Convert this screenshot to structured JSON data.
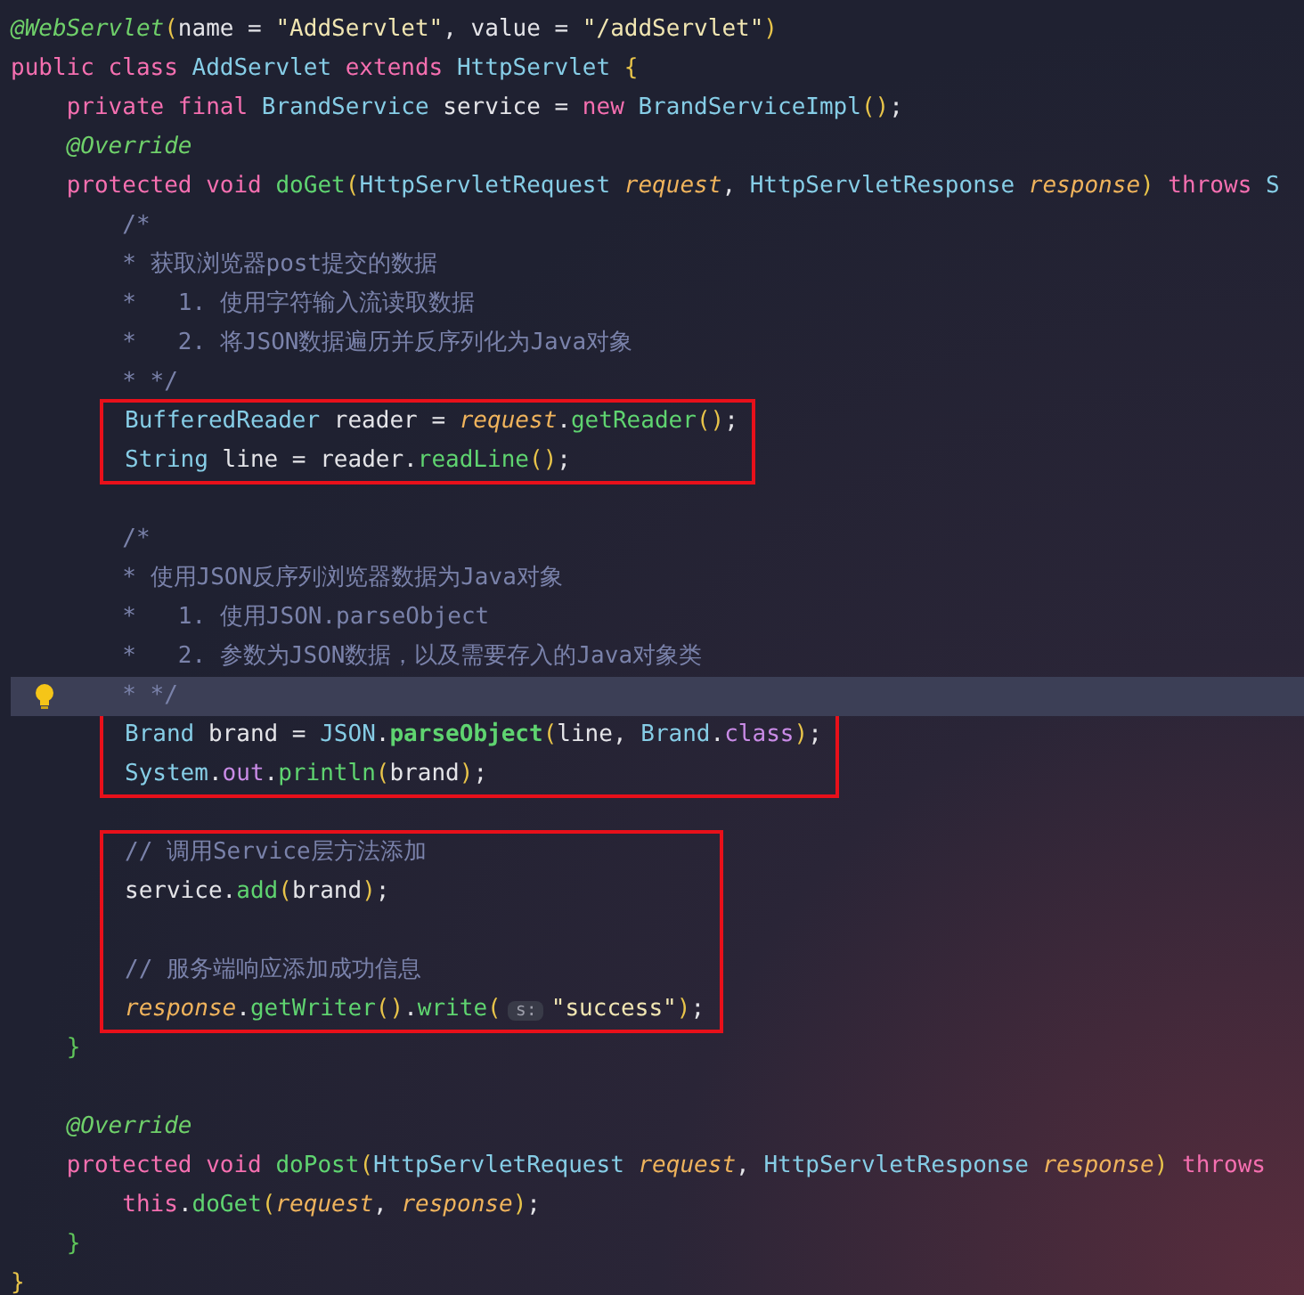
{
  "editor": {
    "blocks": [
      {
        "boxed": false,
        "lines": [
          {
            "current": false,
            "tokens": [
              {
                "text": "@WebServlet",
                "kind": "annotation"
              },
              {
                "text": "(",
                "kind": "paren"
              },
              {
                "text": "name = ",
                "kind": "plain"
              },
              {
                "text": "\"AddServlet\"",
                "kind": "string"
              },
              {
                "text": ", value = ",
                "kind": "plain"
              },
              {
                "text": "\"/addServlet\"",
                "kind": "string"
              },
              {
                "text": ")",
                "kind": "paren"
              }
            ]
          },
          {
            "current": false,
            "tokens": [
              {
                "text": "public class ",
                "kind": "keyword"
              },
              {
                "text": "AddServlet ",
                "kind": "type"
              },
              {
                "text": "extends ",
                "kind": "keyword"
              },
              {
                "text": "HttpServlet ",
                "kind": "type"
              },
              {
                "text": "{",
                "kind": "paren"
              }
            ]
          },
          {
            "current": false,
            "tokens": [
              {
                "text": "    private final ",
                "kind": "keyword"
              },
              {
                "text": "BrandService ",
                "kind": "type"
              },
              {
                "text": "service = ",
                "kind": "plain"
              },
              {
                "text": "new ",
                "kind": "keyword"
              },
              {
                "text": "BrandServiceImpl",
                "kind": "type"
              },
              {
                "text": "()",
                "kind": "paren"
              },
              {
                "text": ";",
                "kind": "plain"
              }
            ]
          },
          {
            "current": false,
            "tokens": [
              {
                "text": "    @Override",
                "kind": "annotation"
              }
            ]
          },
          {
            "current": false,
            "tokens": [
              {
                "text": "    protected void ",
                "kind": "keyword"
              },
              {
                "text": "doGet",
                "kind": "method"
              },
              {
                "text": "(",
                "kind": "paren"
              },
              {
                "text": "HttpServletRequest ",
                "kind": "type"
              },
              {
                "text": "request",
                "kind": "param"
              },
              {
                "text": ", ",
                "kind": "plain"
              },
              {
                "text": "HttpServletResponse ",
                "kind": "type"
              },
              {
                "text": "response",
                "kind": "param"
              },
              {
                "text": ")",
                "kind": "paren"
              },
              {
                "text": " throws ",
                "kind": "keyword"
              },
              {
                "text": "S",
                "kind": "type"
              }
            ]
          },
          {
            "current": false,
            "tokens": [
              {
                "text": "        /*",
                "kind": "comment"
              }
            ]
          },
          {
            "current": false,
            "tokens": [
              {
                "text": "        * 获取浏览器post提交的数据",
                "kind": "comment"
              }
            ]
          },
          {
            "current": false,
            "tokens": [
              {
                "text": "        *   1. 使用字符输入流读取数据",
                "kind": "comment"
              }
            ]
          },
          {
            "current": false,
            "tokens": [
              {
                "text": "        *   2. 将JSON数据遍历并反序列化为Java对象",
                "kind": "comment"
              }
            ]
          },
          {
            "current": false,
            "tokens": [
              {
                "text": "        * */",
                "kind": "comment"
              }
            ]
          }
        ]
      },
      {
        "boxed": true,
        "lines": [
          {
            "current": false,
            "tokens": [
              {
                "text": "BufferedReader ",
                "kind": "type"
              },
              {
                "text": "reader = ",
                "kind": "plain"
              },
              {
                "text": "request",
                "kind": "param"
              },
              {
                "text": ".",
                "kind": "plain"
              },
              {
                "text": "getReader",
                "kind": "method"
              },
              {
                "text": "()",
                "kind": "paren"
              },
              {
                "text": ";",
                "kind": "plain"
              }
            ]
          },
          {
            "current": false,
            "tokens": [
              {
                "text": "String ",
                "kind": "type"
              },
              {
                "text": "line = reader.",
                "kind": "plain"
              },
              {
                "text": "readLine",
                "kind": "method"
              },
              {
                "text": "()",
                "kind": "paren"
              },
              {
                "text": ";",
                "kind": "plain"
              }
            ]
          }
        ]
      },
      {
        "boxed": false,
        "lines": [
          {
            "current": false
          },
          {
            "current": false,
            "tokens": [
              {
                "text": "        /*",
                "kind": "comment"
              }
            ]
          },
          {
            "current": false,
            "tokens": [
              {
                "text": "        * 使用JSON反序列浏览器数据为Java对象",
                "kind": "comment"
              }
            ]
          },
          {
            "current": false,
            "tokens": [
              {
                "text": "        *   1. 使用JSON.parseObject",
                "kind": "comment"
              }
            ]
          },
          {
            "current": false,
            "tokens": [
              {
                "text": "        *   2. 参数为JSON数据，以及需要存入的Java对象类",
                "kind": "comment"
              }
            ]
          },
          {
            "current": true,
            "tokens": [
              {
                "text": "        * */",
                "kind": "comment"
              }
            ]
          }
        ]
      },
      {
        "boxed": true,
        "lines": [
          {
            "current": false,
            "tokens": [
              {
                "text": "Brand ",
                "kind": "type"
              },
              {
                "text": "brand = ",
                "kind": "plain"
              },
              {
                "text": "JSON",
                "kind": "type"
              },
              {
                "text": ".",
                "kind": "plain"
              },
              {
                "text": "parseObject",
                "kind": "method_bold"
              },
              {
                "text": "(",
                "kind": "paren"
              },
              {
                "text": "line, ",
                "kind": "plain"
              },
              {
                "text": "Brand",
                "kind": "type"
              },
              {
                "text": ".",
                "kind": "plain"
              },
              {
                "text": "class",
                "kind": "field"
              },
              {
                "text": ")",
                "kind": "paren"
              },
              {
                "text": ";",
                "kind": "plain"
              }
            ]
          },
          {
            "current": false,
            "tokens": [
              {
                "text": "System",
                "kind": "type"
              },
              {
                "text": ".",
                "kind": "plain"
              },
              {
                "text": "out",
                "kind": "field"
              },
              {
                "text": ".",
                "kind": "plain"
              },
              {
                "text": "println",
                "kind": "method"
              },
              {
                "text": "(",
                "kind": "paren"
              },
              {
                "text": "brand",
                "kind": "plain"
              },
              {
                "text": ")",
                "kind": "paren"
              },
              {
                "text": ";",
                "kind": "plain"
              }
            ]
          }
        ]
      },
      {
        "boxed": false,
        "lines": [
          {
            "current": false
          }
        ]
      },
      {
        "boxed": true,
        "lines": [
          {
            "current": false,
            "tokens": [
              {
                "text": "// 调用Service层方法添加",
                "kind": "comment"
              }
            ]
          },
          {
            "current": false,
            "tokens": [
              {
                "text": "service.",
                "kind": "plain"
              },
              {
                "text": "add",
                "kind": "method"
              },
              {
                "text": "(",
                "kind": "paren"
              },
              {
                "text": "brand",
                "kind": "plain"
              },
              {
                "text": ")",
                "kind": "paren"
              },
              {
                "text": ";",
                "kind": "plain"
              }
            ]
          },
          {
            "current": false
          },
          {
            "current": false,
            "tokens": [
              {
                "text": "// 服务端响应添加成功信息",
                "kind": "comment"
              }
            ]
          },
          {
            "current": false,
            "tokens": [
              {
                "text": "response",
                "kind": "param"
              },
              {
                "text": ".",
                "kind": "plain"
              },
              {
                "text": "getWriter",
                "kind": "method"
              },
              {
                "text": "()",
                "kind": "paren"
              },
              {
                "text": ".",
                "kind": "plain"
              },
              {
                "text": "write",
                "kind": "method"
              },
              {
                "text": "(",
                "kind": "paren"
              },
              {
                "text": "s:",
                "kind": "hint"
              },
              {
                "text": "\"success\"",
                "kind": "string"
              },
              {
                "text": ")",
                "kind": "paren"
              },
              {
                "text": ";",
                "kind": "plain"
              }
            ]
          }
        ]
      },
      {
        "boxed": false,
        "lines": [
          {
            "current": false,
            "tokens": [
              {
                "text": "    }",
                "kind": "brace"
              }
            ]
          },
          {
            "current": false
          },
          {
            "current": false,
            "tokens": [
              {
                "text": "    @Override",
                "kind": "annotation"
              }
            ]
          },
          {
            "current": false,
            "tokens": [
              {
                "text": "    protected void ",
                "kind": "keyword"
              },
              {
                "text": "doPost",
                "kind": "method"
              },
              {
                "text": "(",
                "kind": "paren"
              },
              {
                "text": "HttpServletRequest ",
                "kind": "type"
              },
              {
                "text": "request",
                "kind": "param"
              },
              {
                "text": ", ",
                "kind": "plain"
              },
              {
                "text": "HttpServletResponse ",
                "kind": "type"
              },
              {
                "text": "response",
                "kind": "param"
              },
              {
                "text": ")",
                "kind": "paren"
              },
              {
                "text": " throws",
                "kind": "keyword"
              }
            ]
          },
          {
            "current": false,
            "tokens": [
              {
                "text": "        this",
                "kind": "keyword"
              },
              {
                "text": ".",
                "kind": "plain"
              },
              {
                "text": "doGet",
                "kind": "method"
              },
              {
                "text": "(",
                "kind": "paren"
              },
              {
                "text": "request",
                "kind": "param"
              },
              {
                "text": ", ",
                "kind": "plain"
              },
              {
                "text": "response",
                "kind": "param"
              },
              {
                "text": ")",
                "kind": "paren"
              },
              {
                "text": ";",
                "kind": "plain"
              }
            ]
          },
          {
            "current": false,
            "tokens": [
              {
                "text": "    }",
                "kind": "brace"
              }
            ]
          },
          {
            "current": false,
            "tokens": [
              {
                "text": "}",
                "kind": "paren"
              }
            ]
          }
        ]
      }
    ]
  }
}
